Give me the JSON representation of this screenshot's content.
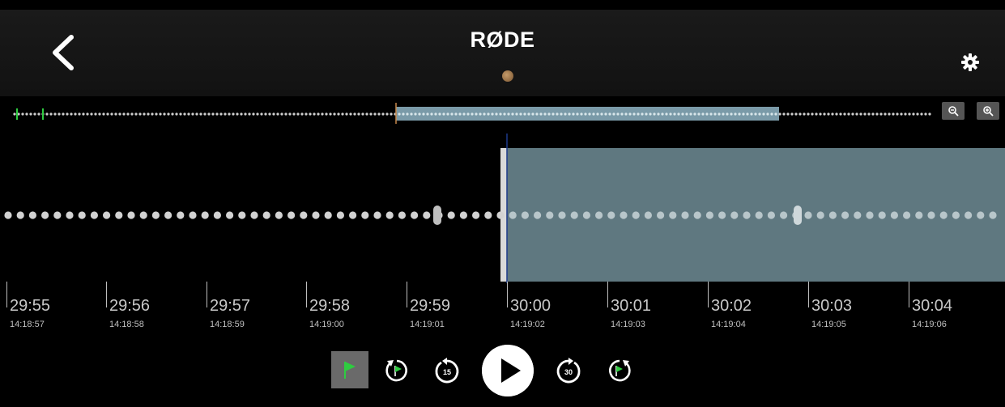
{
  "header": {
    "brand": "RØDE",
    "back_icon": "chevron-left-icon",
    "settings_icon": "gear-icon",
    "status_color": "#a57a4a"
  },
  "overview": {
    "zoom_out_icon": "zoom-out-icon",
    "zoom_in_icon": "zoom-in-icon",
    "selection_color": "#7a9aa8"
  },
  "waveform": {
    "selection_color": "#5f7880"
  },
  "timeline": {
    "ticks": [
      {
        "tc": "29:55",
        "clock": "14:18:57"
      },
      {
        "tc": "29:56",
        "clock": "14:18:58"
      },
      {
        "tc": "29:57",
        "clock": "14:18:59"
      },
      {
        "tc": "29:58",
        "clock": "14:19:00"
      },
      {
        "tc": "29:59",
        "clock": "14:19:01"
      },
      {
        "tc": "30:00",
        "clock": "14:19:02"
      },
      {
        "tc": "30:01",
        "clock": "14:19:03"
      },
      {
        "tc": "30:02",
        "clock": "14:19:04"
      },
      {
        "tc": "30:03",
        "clock": "14:19:05"
      },
      {
        "tc": "30:04",
        "clock": "14:19:06"
      }
    ]
  },
  "transport": {
    "flag_icon": "flag-icon",
    "prev_marker_icon": "previous-marker-icon",
    "skip_back_label": "15",
    "play_icon": "play-icon",
    "skip_forward_label": "30",
    "next_marker_icon": "next-marker-icon",
    "accent_color": "#2ecc40"
  }
}
